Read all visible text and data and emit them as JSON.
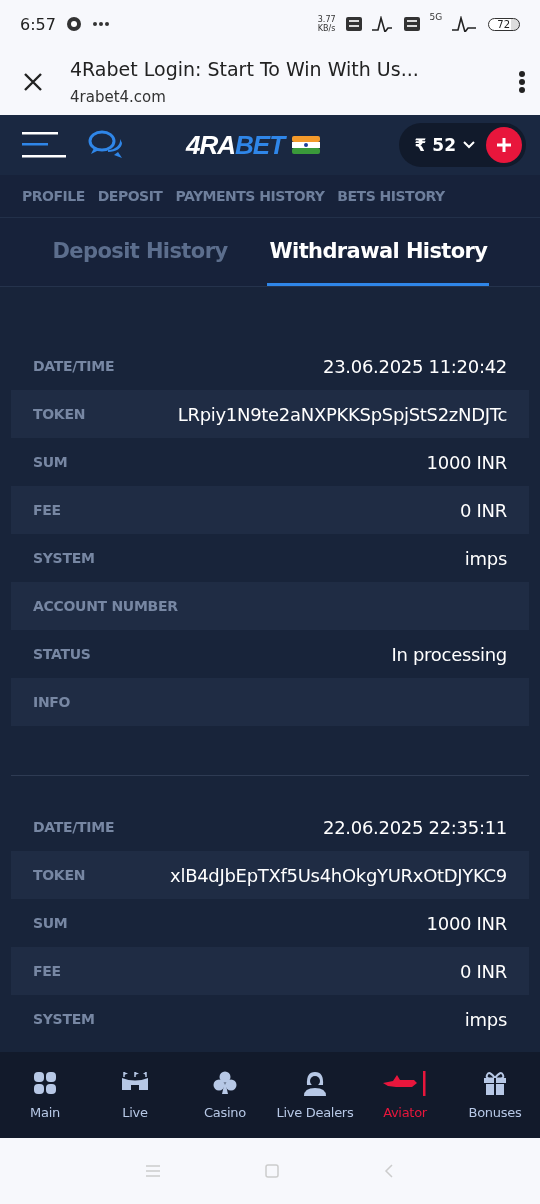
{
  "status_bar": {
    "time": "6:57",
    "speed_value": "3.77",
    "speed_unit": "KB/s",
    "network": "5G",
    "battery": "72"
  },
  "browser_bar": {
    "title": "4Rabet Login: Start To Win With Us...",
    "url": "4rabet4.com"
  },
  "header": {
    "logo": {
      "lead": "4RA",
      "tail": "BET"
    },
    "balance": "₹ 52"
  },
  "subnav": [
    "PROFILE",
    "DEPOSIT",
    "PAYMENTS HISTORY",
    "BETS HISTORY"
  ],
  "tabs": [
    {
      "label": "Deposit History",
      "selected": false
    },
    {
      "label": "Withdrawal History",
      "selected": true
    }
  ],
  "records": [
    {
      "fields": [
        {
          "label": "DATE/TIME",
          "value": "23.06.2025 11:20:42"
        },
        {
          "label": "TOKEN",
          "value": "LRpiy1N9te2aNXPKKSpSpjStS2zNDJTc"
        },
        {
          "label": "SUM",
          "value": "1000 INR"
        },
        {
          "label": "FEE",
          "value": "0 INR"
        },
        {
          "label": "SYSTEM",
          "value": "imps"
        },
        {
          "label": "ACCOUNT NUMBER"
        },
        {
          "label": "STATUS",
          "value": "In processing"
        },
        {
          "label": "INFO"
        }
      ]
    },
    {
      "fields": [
        {
          "label": "DATE/TIME",
          "value": "22.06.2025 22:35:11"
        },
        {
          "label": "TOKEN",
          "value": "xlB4dJbEpTXf5Us4hOkgYURxOtDJYKC9"
        },
        {
          "label": "SUM",
          "value": "1000 INR"
        },
        {
          "label": "FEE",
          "value": "0 INR"
        },
        {
          "label": "SYSTEM",
          "value": "imps"
        }
      ]
    }
  ],
  "bottom_nav": [
    {
      "label": "Main",
      "kind": "grid",
      "selected": false
    },
    {
      "label": "Live",
      "kind": "stadium",
      "selected": false
    },
    {
      "label": "Casino",
      "kind": "club",
      "selected": false
    },
    {
      "label": "Live Dealers",
      "kind": "dealer",
      "selected": false
    },
    {
      "label": "Aviator",
      "kind": "plane",
      "selected": true
    },
    {
      "label": "Bonuses",
      "kind": "gift",
      "selected": false
    }
  ]
}
